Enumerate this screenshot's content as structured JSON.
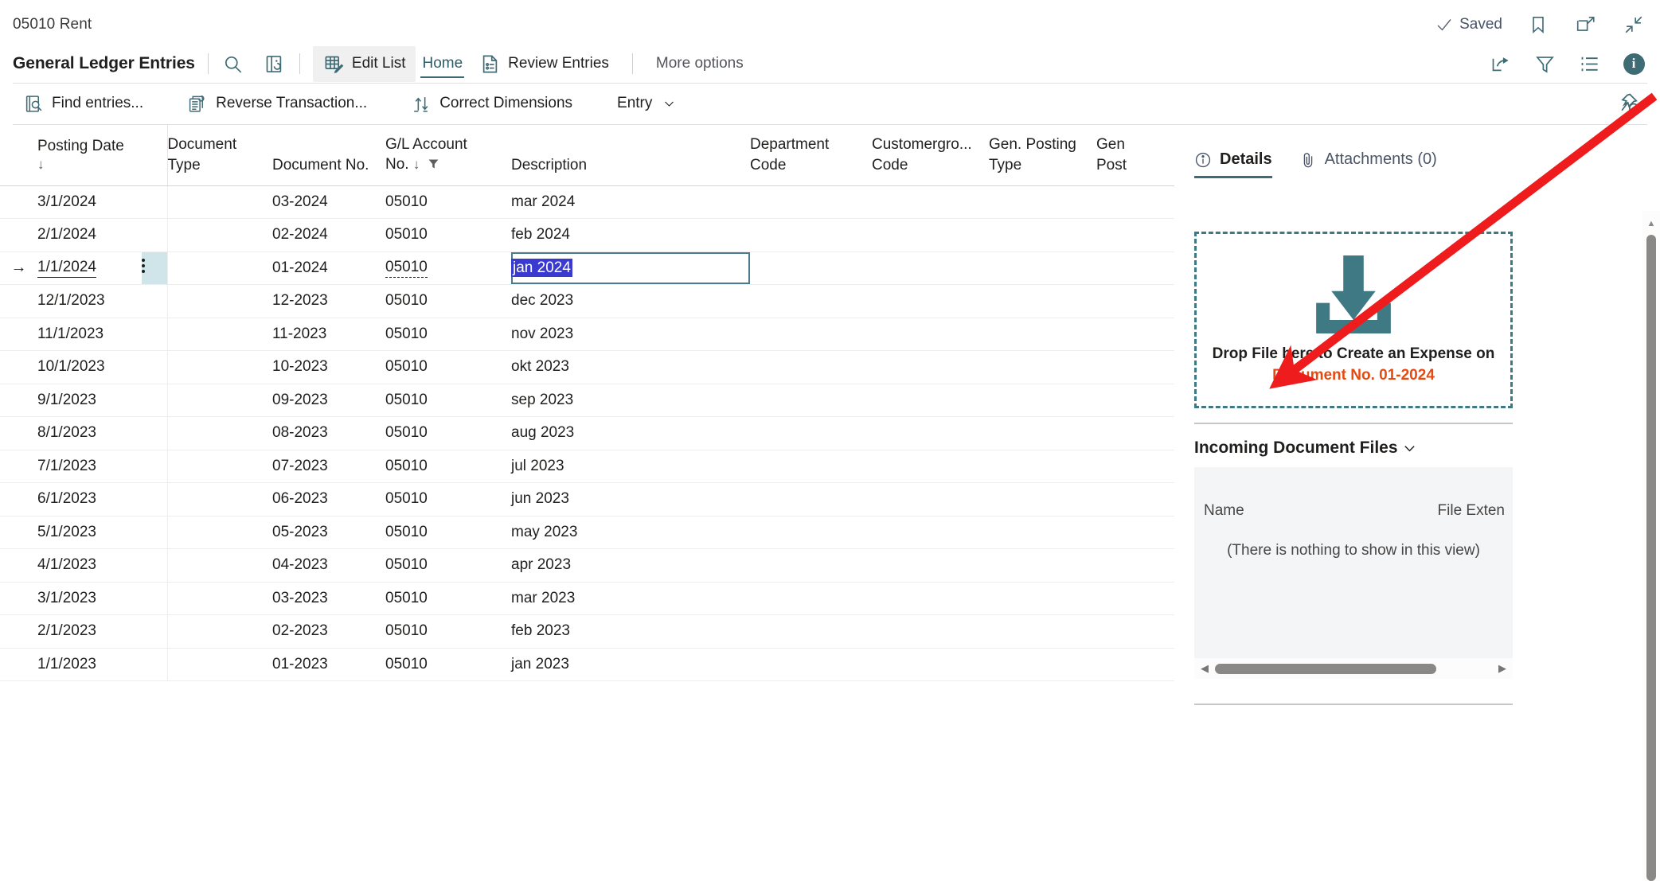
{
  "topbar": {
    "breadcrumb": "05010 Rent",
    "saved_label": "Saved",
    "bookmark_icon": "bookmark-icon",
    "open_new_window_icon": "open-in-new-window-icon",
    "collapse_icon": "minimize-icon"
  },
  "ribbon": {
    "page_title": "General Ledger Entries",
    "search_icon": "search-icon",
    "open_in_excel_icon": "open-in-excel-icon",
    "items": [
      {
        "label": "Edit List",
        "icon": "edit-list-icon",
        "state": "active-box"
      },
      {
        "label": "Home",
        "icon": "",
        "state": "tab-active"
      },
      {
        "label": "Review Entries",
        "icon": "review-entries-icon",
        "state": "normal"
      },
      {
        "label": "More options",
        "icon": "",
        "state": "muted"
      }
    ],
    "right_icons": [
      "share-icon",
      "filter-icon",
      "list-view-icon",
      "info-icon"
    ],
    "info_glyph": "i"
  },
  "actionbar": {
    "items": [
      {
        "label": "Find entries...",
        "icon": "find-entries-icon",
        "caret": false
      },
      {
        "label": "Reverse Transaction...",
        "icon": "reverse-transaction-icon",
        "caret": false
      },
      {
        "label": "Correct Dimensions",
        "icon": "correct-dimensions-icon",
        "caret": false
      },
      {
        "label": "Entry",
        "icon": "",
        "caret": true
      }
    ],
    "unpin_icon": "unpin-icon"
  },
  "grid": {
    "columns": [
      {
        "key": "marker",
        "line1": "",
        "line2": "",
        "sort": ""
      },
      {
        "key": "posting_date",
        "line1": "Posting Date",
        "line2": "",
        "sort": "down"
      },
      {
        "key": "kebab",
        "line1": "",
        "line2": "",
        "sort": ""
      },
      {
        "key": "document_type",
        "line1": "Document",
        "line2": "Type",
        "sort": ""
      },
      {
        "key": "document_no",
        "line1": "",
        "line2": "Document No.",
        "sort": ""
      },
      {
        "key": "gl_account_no",
        "line1": "G/L Account",
        "line2": "No.",
        "sort": "down",
        "filter": true
      },
      {
        "key": "description",
        "line1": "",
        "line2": "Description",
        "sort": ""
      },
      {
        "key": "department_code",
        "line1": "Department",
        "line2": "Code",
        "sort": ""
      },
      {
        "key": "customergroup_code",
        "line1": "Customergro...",
        "line2": "Code",
        "sort": ""
      },
      {
        "key": "gen_posting_type",
        "line1": "Gen. Posting",
        "line2": "Type",
        "sort": ""
      },
      {
        "key": "gen_posting_2",
        "line1": "Gen",
        "line2": "Post",
        "sort": ""
      }
    ],
    "rows": [
      {
        "posting_date": "3/1/2024",
        "document_type": "",
        "document_no": "03-2024",
        "gl_account_no": "05010",
        "description": "mar 2024",
        "department_code": "",
        "customergroup_code": "",
        "gen_posting_type": "",
        "gen_posting_2": "",
        "selected": false
      },
      {
        "posting_date": "2/1/2024",
        "document_type": "",
        "document_no": "02-2024",
        "gl_account_no": "05010",
        "description": "feb 2024",
        "department_code": "",
        "customergroup_code": "",
        "gen_posting_type": "",
        "gen_posting_2": "",
        "selected": false
      },
      {
        "posting_date": "1/1/2024",
        "document_type": "",
        "document_no": "01-2024",
        "gl_account_no": "05010",
        "description": "jan 2024",
        "department_code": "",
        "customergroup_code": "",
        "gen_posting_type": "",
        "gen_posting_2": "",
        "selected": true
      },
      {
        "posting_date": "12/1/2023",
        "document_type": "",
        "document_no": "12-2023",
        "gl_account_no": "05010",
        "description": "dec 2023",
        "department_code": "",
        "customergroup_code": "",
        "gen_posting_type": "",
        "gen_posting_2": "",
        "selected": false
      },
      {
        "posting_date": "11/1/2023",
        "document_type": "",
        "document_no": "11-2023",
        "gl_account_no": "05010",
        "description": "nov 2023",
        "department_code": "",
        "customergroup_code": "",
        "gen_posting_type": "",
        "gen_posting_2": "",
        "selected": false
      },
      {
        "posting_date": "10/1/2023",
        "document_type": "",
        "document_no": "10-2023",
        "gl_account_no": "05010",
        "description": "okt 2023",
        "department_code": "",
        "customergroup_code": "",
        "gen_posting_type": "",
        "gen_posting_2": "",
        "selected": false
      },
      {
        "posting_date": "9/1/2023",
        "document_type": "",
        "document_no": "09-2023",
        "gl_account_no": "05010",
        "description": "sep 2023",
        "department_code": "",
        "customergroup_code": "",
        "gen_posting_type": "",
        "gen_posting_2": "",
        "selected": false
      },
      {
        "posting_date": "8/1/2023",
        "document_type": "",
        "document_no": "08-2023",
        "gl_account_no": "05010",
        "description": "aug 2023",
        "department_code": "",
        "customergroup_code": "",
        "gen_posting_type": "",
        "gen_posting_2": "",
        "selected": false
      },
      {
        "posting_date": "7/1/2023",
        "document_type": "",
        "document_no": "07-2023",
        "gl_account_no": "05010",
        "description": "jul 2023",
        "department_code": "",
        "customergroup_code": "",
        "gen_posting_type": "",
        "gen_posting_2": "",
        "selected": false
      },
      {
        "posting_date": "6/1/2023",
        "document_type": "",
        "document_no": "06-2023",
        "gl_account_no": "05010",
        "description": "jun 2023",
        "department_code": "",
        "customergroup_code": "",
        "gen_posting_type": "",
        "gen_posting_2": "",
        "selected": false
      },
      {
        "posting_date": "5/1/2023",
        "document_type": "",
        "document_no": "05-2023",
        "gl_account_no": "05010",
        "description": "may 2023",
        "department_code": "",
        "customergroup_code": "",
        "gen_posting_type": "",
        "gen_posting_2": "",
        "selected": false
      },
      {
        "posting_date": "4/1/2023",
        "document_type": "",
        "document_no": "04-2023",
        "gl_account_no": "05010",
        "description": "apr 2023",
        "department_code": "",
        "customergroup_code": "",
        "gen_posting_type": "",
        "gen_posting_2": "",
        "selected": false
      },
      {
        "posting_date": "3/1/2023",
        "document_type": "",
        "document_no": "03-2023",
        "gl_account_no": "05010",
        "description": "mar 2023",
        "department_code": "",
        "customergroup_code": "",
        "gen_posting_type": "",
        "gen_posting_2": "",
        "selected": false
      },
      {
        "posting_date": "2/1/2023",
        "document_type": "",
        "document_no": "02-2023",
        "gl_account_no": "05010",
        "description": "feb 2023",
        "department_code": "",
        "customergroup_code": "",
        "gen_posting_type": "",
        "gen_posting_2": "",
        "selected": false
      },
      {
        "posting_date": "1/1/2023",
        "document_type": "",
        "document_no": "01-2023",
        "gl_account_no": "05010",
        "description": "jan 2023",
        "department_code": "",
        "customergroup_code": "",
        "gen_posting_type": "",
        "gen_posting_2": "",
        "selected": false
      }
    ],
    "row_marker_glyph": "→"
  },
  "factbox": {
    "tabs": [
      {
        "label": "Details",
        "icon": "info-circle-icon",
        "selected": true
      },
      {
        "label": "Attachments (0)",
        "icon": "paperclip-icon",
        "selected": false
      }
    ],
    "dropzone": {
      "icon": "download-into-tray-icon",
      "line1": "Drop File here to Create an Expense on",
      "line2": "Document No. 01-2024",
      "line2_color": "#e8490e"
    },
    "incoming": {
      "title": "Incoming Document Files",
      "expander_icon": "chevron-down-icon",
      "col_name": "Name",
      "col_ext": "File Exten",
      "empty_text": "(There is nothing to show in this view)"
    }
  },
  "colors": {
    "accent_teal": "#3f6b75",
    "dropzone_teal": "#3f7a84",
    "selection_blue": "#3a3ad0",
    "row_highlight": "#cfe5ea",
    "annotation_red": "#ee1c1c"
  }
}
